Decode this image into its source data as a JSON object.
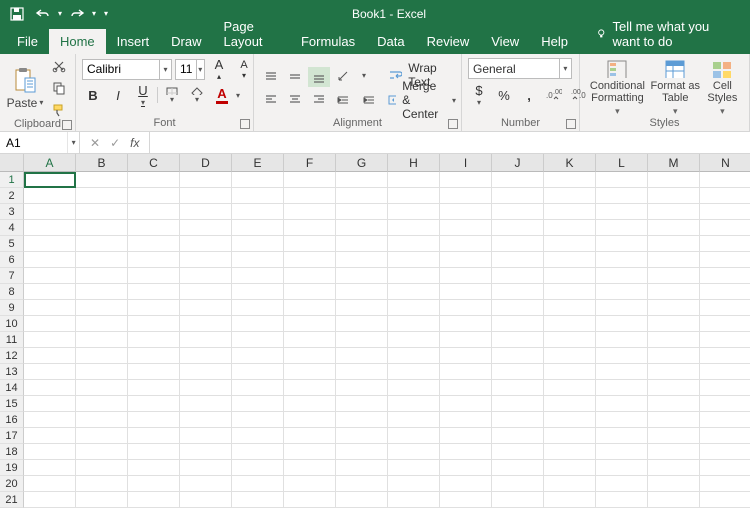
{
  "app": {
    "title": "Book1  -  Excel"
  },
  "tabs": {
    "file": "File",
    "home": "Home",
    "insert": "Insert",
    "draw": "Draw",
    "pageLayout": "Page Layout",
    "formulas": "Formulas",
    "data": "Data",
    "review": "Review",
    "view": "View",
    "help": "Help",
    "tell": "Tell me what you want to do",
    "active": "home"
  },
  "ribbon": {
    "clipboard": {
      "paste": "Paste",
      "group": "Clipboard"
    },
    "font": {
      "name": "Calibri",
      "size": "11",
      "group": "Font"
    },
    "alignment": {
      "wrap": "Wrap Text",
      "merge": "Merge & Center",
      "group": "Alignment"
    },
    "number": {
      "format": "General",
      "group": "Number"
    },
    "styles": {
      "cond": "Conditional Formatting",
      "table": "Format as Table",
      "cell": "Cell Styles",
      "group": "Styles"
    }
  },
  "formulaBar": {
    "nameBox": "A1",
    "fx": "fx",
    "formula": ""
  },
  "columns": [
    "A",
    "B",
    "C",
    "D",
    "E",
    "F",
    "G",
    "H",
    "I",
    "J",
    "K",
    "L",
    "M",
    "N"
  ],
  "rows": [
    "1",
    "2",
    "3",
    "4",
    "5",
    "6",
    "7",
    "8",
    "9",
    "10",
    "11",
    "12",
    "13",
    "14",
    "15",
    "16",
    "17",
    "18",
    "19",
    "20",
    "21"
  ],
  "selected": "A1"
}
